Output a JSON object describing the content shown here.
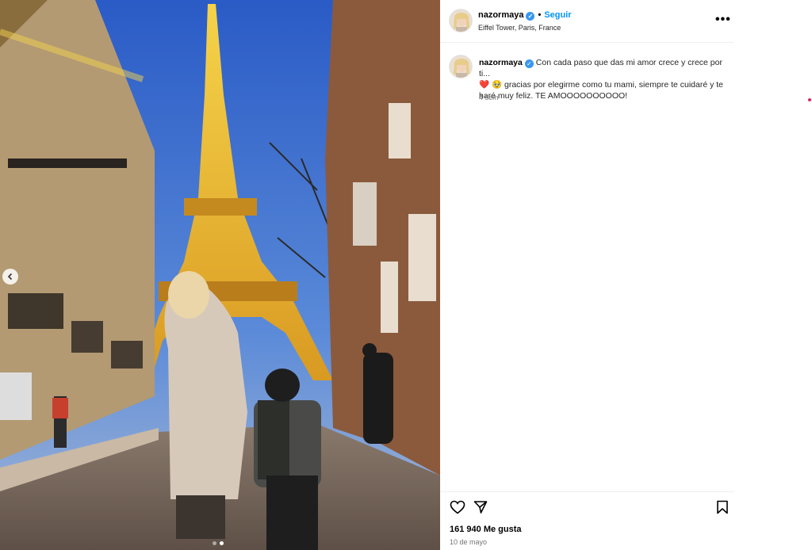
{
  "post": {
    "username": "nazormaya",
    "separator": "•",
    "follow_label": "Seguir",
    "location": "Eiffel Tower, Paris, France",
    "more_label": "•••"
  },
  "caption": {
    "username": "nazormaya",
    "line1": "Con cada paso que das mi amor crece y crece por ti...",
    "emoji1": "❤️",
    "emoji2": "🥹",
    "line2": "gracias por elegirme como tu mami, siempre te cuidaré y te haré muy feliz. TE AMOOOOOOOOOO!",
    "time": "4 sem"
  },
  "actions": {
    "icons": [
      "heart-icon",
      "share-icon",
      "bookmark-icon"
    ],
    "likes": "161 940 Me gusta",
    "date": "10 de mayo"
  },
  "media": {
    "description_icons": [
      "chevron-left-icon"
    ],
    "carousel_count": 2,
    "carousel_active": 2
  },
  "colors": {
    "verified": "#3897f0",
    "follow": "#0095f6",
    "sky_top": "#2f5fc4",
    "tower": "#e8b836"
  }
}
